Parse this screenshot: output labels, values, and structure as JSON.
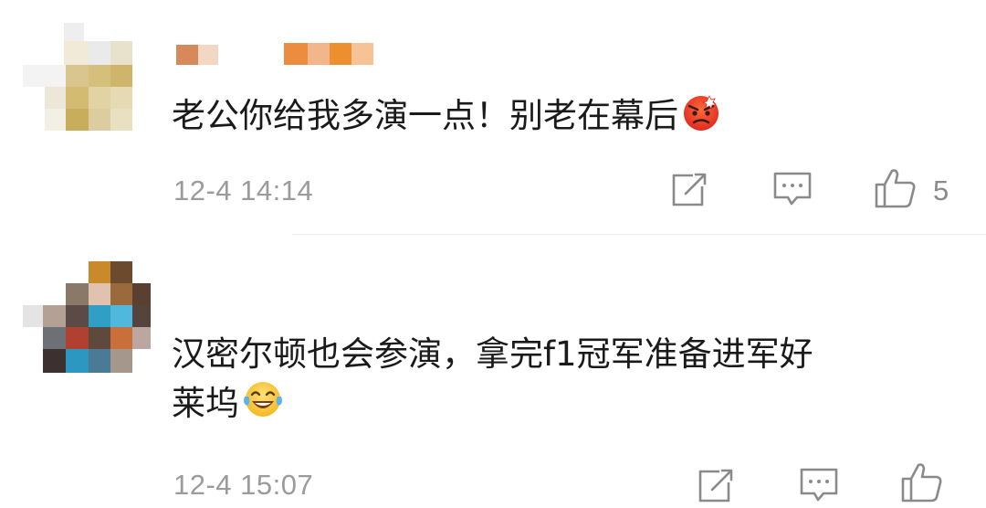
{
  "comments": [
    {
      "text": "老公你给我多演一点！别老在幕后",
      "emoji": "angry-face",
      "time": "12-4 14:14",
      "actions": {
        "share_icon": "share-icon",
        "comment_icon": "comment-icon",
        "like_icon": "like-icon",
        "like_count": "5"
      }
    },
    {
      "text_line1": "汉密尔顿也会参演，拿完f1冠军准备进军好",
      "text_line2": "莱坞",
      "emoji": "tears-of-joy-face",
      "time": "12-4 15:07",
      "actions": {
        "share_icon": "share-icon",
        "comment_icon": "comment-icon",
        "like_icon": "like-icon"
      }
    }
  ],
  "colors": {
    "text": "#1a1a1a",
    "meta": "#9b9b9b",
    "icon": "#8a8a8a",
    "divider": "#ececec"
  }
}
